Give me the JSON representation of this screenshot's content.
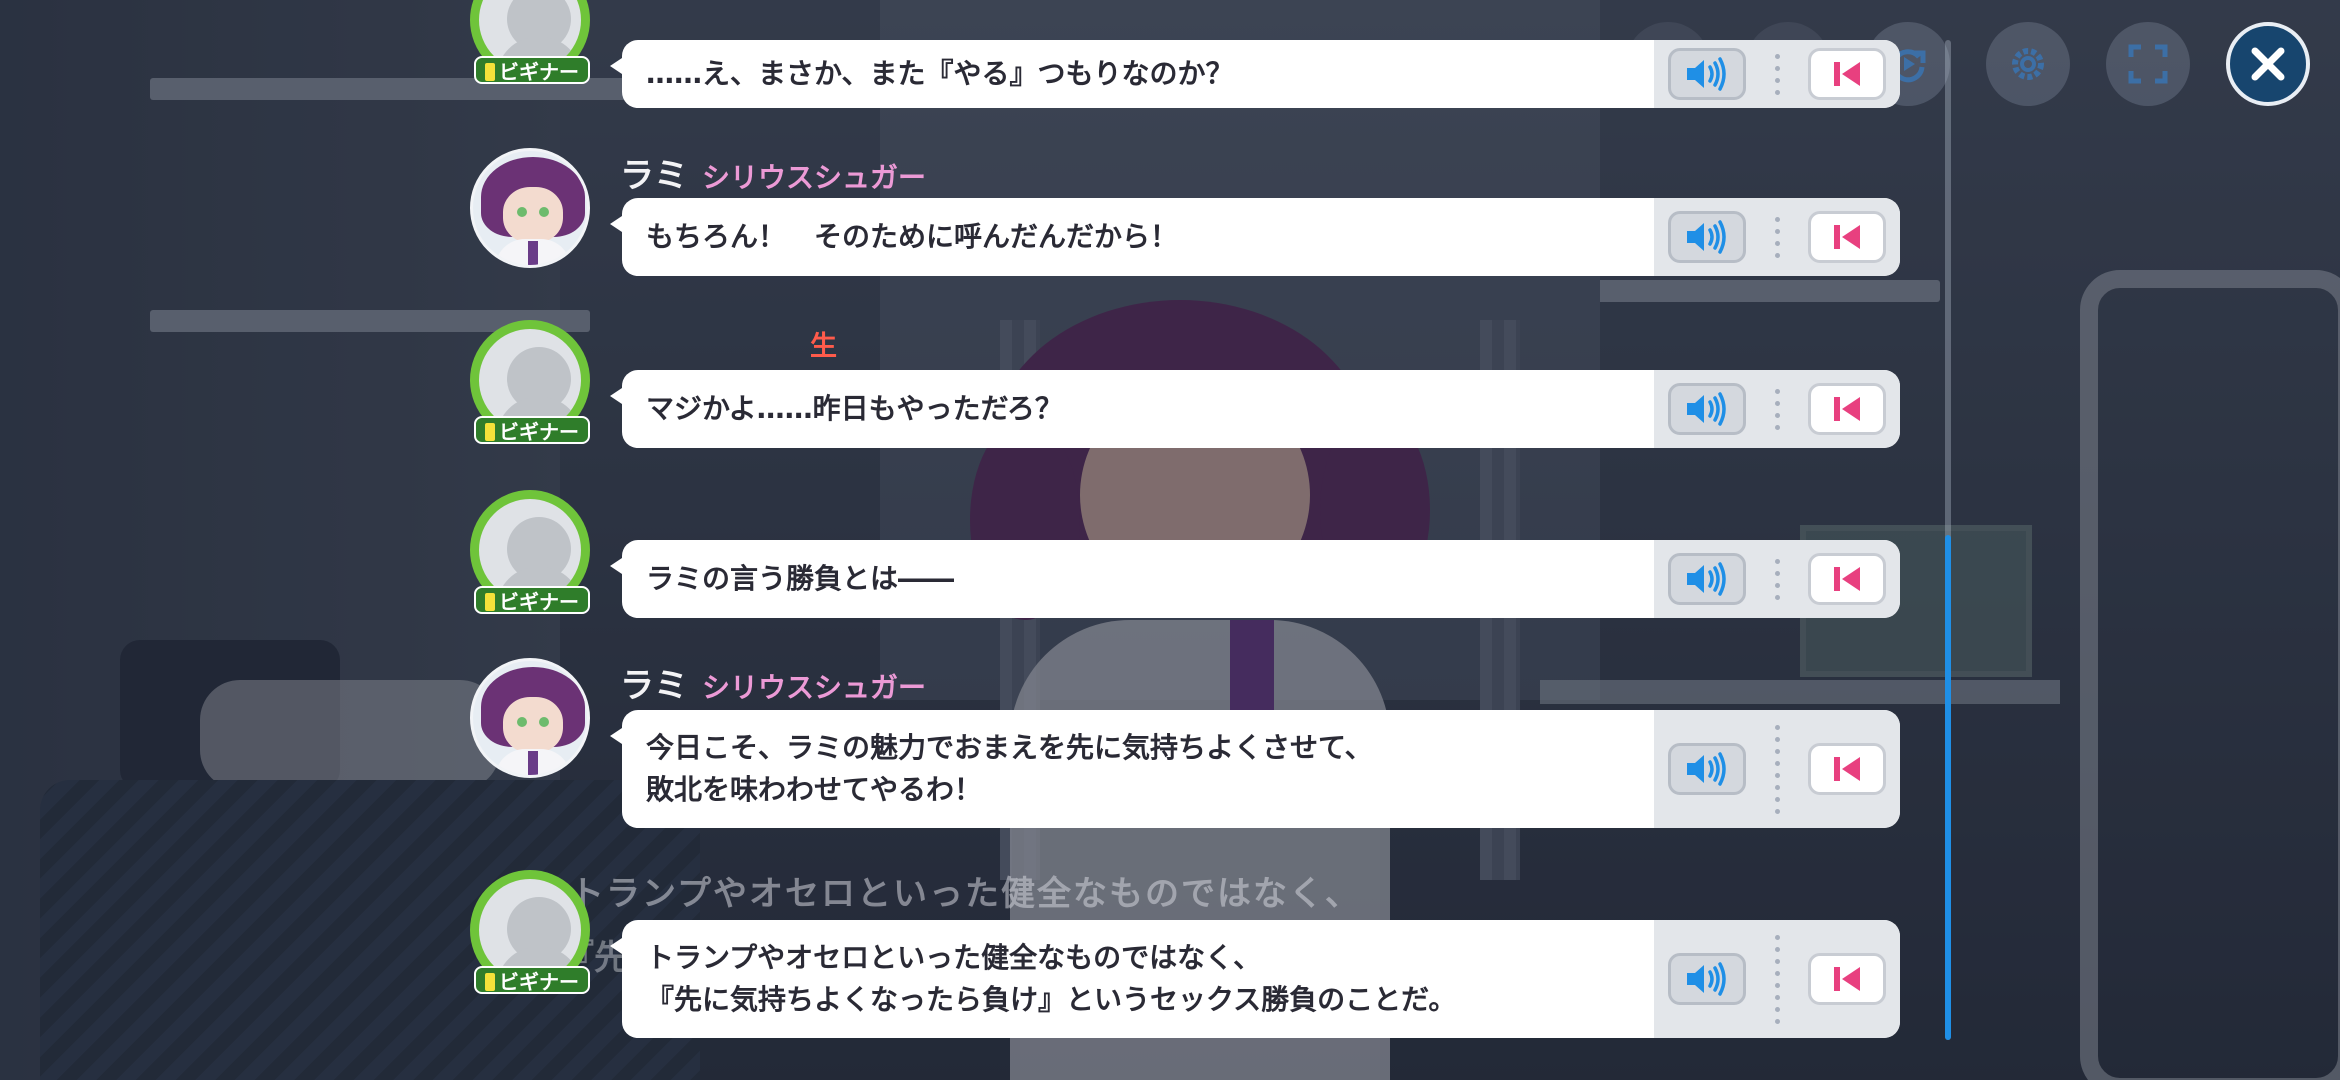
{
  "background": {
    "narration_echo": "トランプやオセロといった健全なものではなく、",
    "narration_echo_fragment": "『先"
  },
  "toolbar": {
    "buttons": [
      {
        "icon": "auto-icon"
      },
      {
        "icon": "skip-icon"
      },
      {
        "icon": "replay-icon"
      },
      {
        "icon": "gear-icon"
      },
      {
        "icon": "fullscreen-icon"
      },
      {
        "icon": "close-icon"
      }
    ]
  },
  "entries": [
    {
      "speaker": "",
      "affiliation": "",
      "tag": "",
      "avatar": "beginner",
      "badge": "ビギナー",
      "text": "……え、まさか、また『やる』つもりなのか？"
    },
    {
      "speaker": "ラミ",
      "affiliation": "シリウスシュガー",
      "tag": "",
      "avatar": "lami",
      "badge": "",
      "text": "もちろん！　そのために呼んだんだから！"
    },
    {
      "speaker": "",
      "affiliation": "",
      "tag": "生徒会",
      "avatar": "beginner",
      "badge": "ビギナー",
      "text": "マジかよ……昨日もやっただろ？"
    },
    {
      "speaker": "",
      "affiliation": "",
      "tag": "",
      "avatar": "beginner",
      "badge": "ビギナー",
      "text": "ラミの言う勝負とは――"
    },
    {
      "speaker": "ラミ",
      "affiliation": "シリウスシュガー",
      "tag": "",
      "avatar": "lami",
      "badge": "",
      "text": "今日こそ、ラミの魅力でおまえを先に気持ちよくさせて、\n敗北を味わわせてやるわ！"
    },
    {
      "speaker": "",
      "affiliation": "",
      "tag": "",
      "avatar": "beginner",
      "badge": "ビギナー",
      "text": "トランプやオセロといった健全なものではなく、\n『先に気持ちよくなったら負け』というセックス勝負のことだ。"
    }
  ],
  "colors": {
    "accent_blue": "#1f8fe6",
    "name_pink": "#ec9ad6",
    "tag_red": "#ff5b4b",
    "beginner_green": "#6fc43a"
  }
}
